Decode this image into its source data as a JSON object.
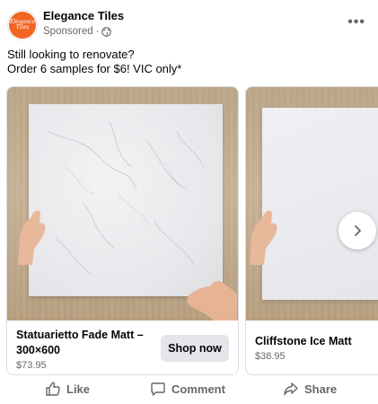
{
  "post": {
    "page_name": "Elegance Tiles",
    "avatar_text_line1": "Elegance",
    "avatar_text_line2": "Tiles",
    "sponsored": "Sponsored",
    "separator": "·",
    "more_label": "•••",
    "text_line1": "Still looking to renovate?",
    "text_line2": "Order 6 samples for $6! VIC only*"
  },
  "carousel": {
    "cards": [
      {
        "title": "Statuarietto Fade Matt – 300×600",
        "price": "$73.95",
        "cta": "Shop now"
      },
      {
        "title": "Cliffstone Ice Matt",
        "price": "$38.95"
      }
    ],
    "next_icon": "chevron-right-icon"
  },
  "actions": {
    "like": "Like",
    "comment": "Comment",
    "share": "Share"
  },
  "colors": {
    "brand_orange": "#f26522",
    "secondary_text": "#65676b",
    "button_bg": "#e4e6eb"
  }
}
